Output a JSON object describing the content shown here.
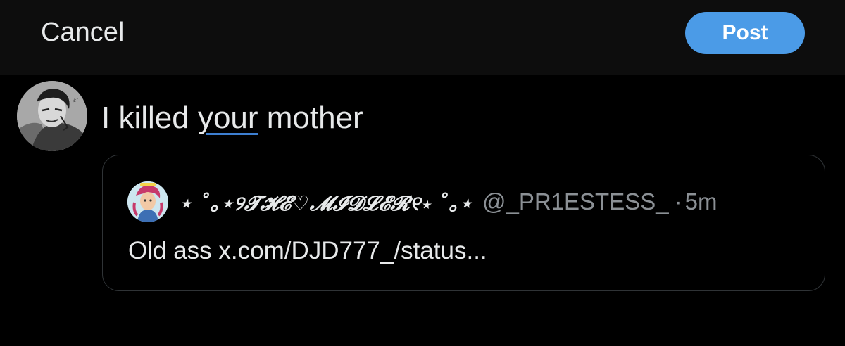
{
  "header": {
    "cancel_label": "Cancel",
    "post_label": "Post"
  },
  "compose": {
    "text_before": "I killed ",
    "text_underlined": "your",
    "text_after": " mother"
  },
  "quoted_post": {
    "display_name": "⋆ ˚｡⋆୨𝓣𝓗𝓔♡𝓜𝓘𝓓𝓛𝓔𝓡୧⋆ ˚｡⋆",
    "handle": "@_PR1ESTESS_",
    "separator": "·",
    "time": "5m",
    "body": "Old ass x.com/DJD777_/status..."
  },
  "colors": {
    "background": "#000000",
    "topbar": "#0d0d0d",
    "post_button": "#4b9be7",
    "muted_text": "#8b9095",
    "border": "#2f3336"
  },
  "icons": {
    "user_avatar": "manga-character-avatar",
    "quoted_avatar": "anime-character-avatar"
  }
}
